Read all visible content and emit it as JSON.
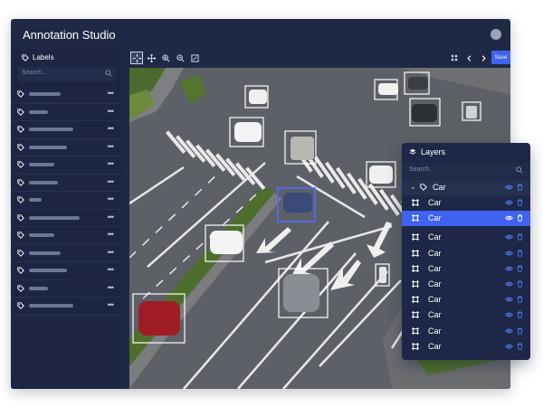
{
  "app": {
    "title": "Annotation Studio"
  },
  "sidebar": {
    "title": "Labels",
    "search_placeholder": "Search...",
    "rows": [
      {
        "bar_fraction": 0.5
      },
      {
        "bar_fraction": 0.3
      },
      {
        "bar_fraction": 0.7
      },
      {
        "bar_fraction": 0.6
      },
      {
        "bar_fraction": 0.4
      },
      {
        "bar_fraction": 0.45
      },
      {
        "bar_fraction": 0.2
      },
      {
        "bar_fraction": 0.8
      },
      {
        "bar_fraction": 0.4
      },
      {
        "bar_fraction": 0.5
      },
      {
        "bar_fraction": 0.6
      },
      {
        "bar_fraction": 0.3
      },
      {
        "bar_fraction": 0.7
      }
    ],
    "row_menu_label": "•••"
  },
  "toolbar": {
    "save_label": "Save"
  },
  "layers": {
    "title": "Layers",
    "search_placeholder": "Search...",
    "group_label": "Car",
    "items": [
      {
        "label": "Car",
        "selected": false
      },
      {
        "label": "Car",
        "selected": true
      },
      {
        "label": "Car",
        "selected": false
      },
      {
        "label": "Car",
        "selected": false
      },
      {
        "label": "Car",
        "selected": false
      },
      {
        "label": "Car",
        "selected": false
      },
      {
        "label": "Car",
        "selected": false
      },
      {
        "label": "Car",
        "selected": false
      },
      {
        "label": "Car",
        "selected": false
      },
      {
        "label": "Car",
        "selected": false
      }
    ]
  },
  "colors": {
    "accent": "#3f63f0",
    "panel": "#1f2845",
    "icon_blue": "#4f7cf7",
    "box_white": "#ffffff",
    "selected_box": "#4f6df5"
  }
}
